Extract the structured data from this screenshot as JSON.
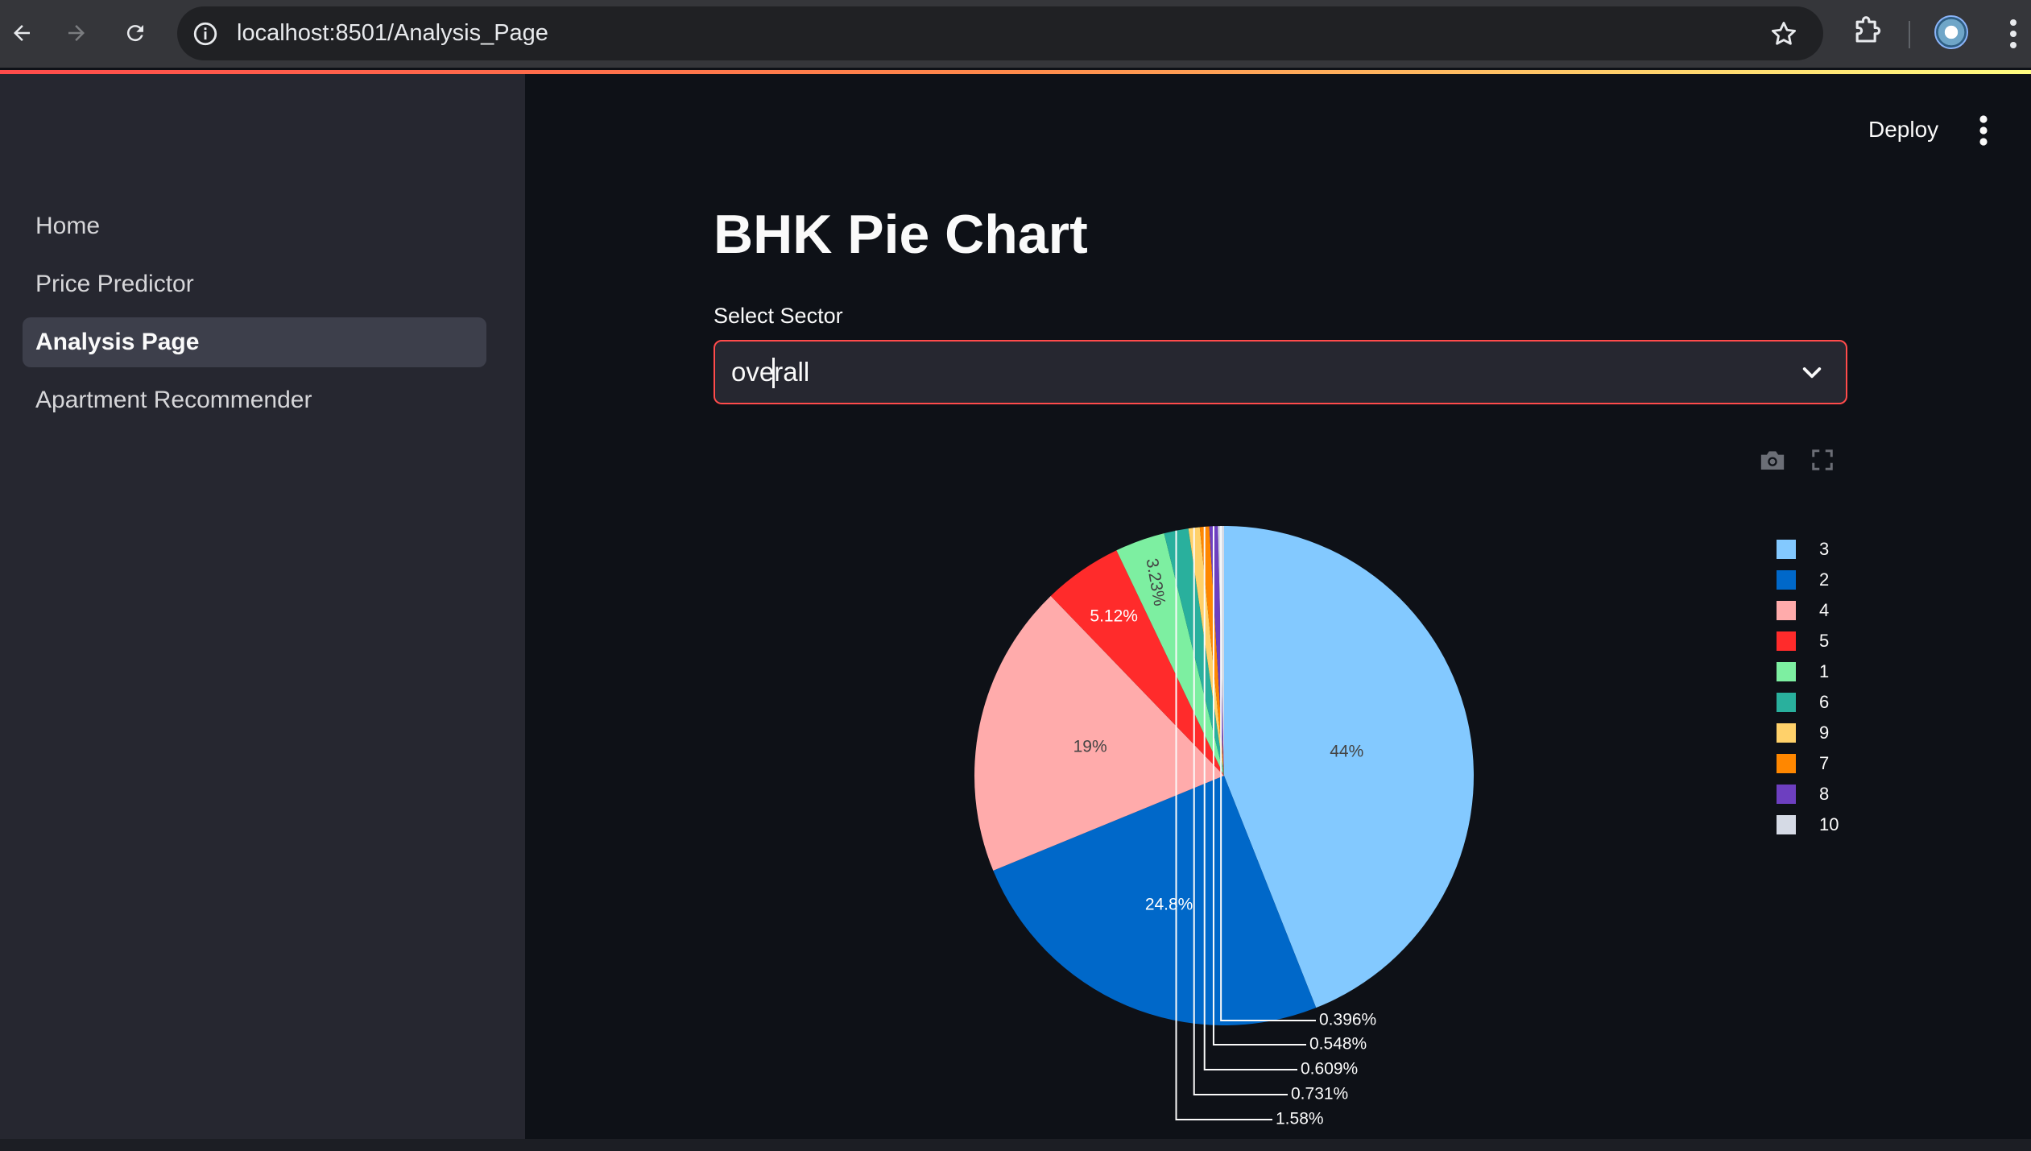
{
  "browser": {
    "url": "localhost:8501/Analysis_Page"
  },
  "sidebar": {
    "items": [
      {
        "label": "Home",
        "active": false
      },
      {
        "label": "Price Predictor",
        "active": false
      },
      {
        "label": "Analysis Page",
        "active": true
      },
      {
        "label": "Apartment Recommender",
        "active": false
      }
    ]
  },
  "header": {
    "deploy_label": "Deploy"
  },
  "main": {
    "title": "BHK Pie Chart",
    "select_label": "Select Sector",
    "select_value": "overall"
  },
  "colors": {
    "accent": "#ff4b4b",
    "background": "#0e1117",
    "sidebar": "#262730"
  },
  "chart_data": {
    "type": "pie",
    "labels": [
      "3",
      "2",
      "4",
      "5",
      "1",
      "6",
      "9",
      "7",
      "8",
      "10"
    ],
    "values": [
      44.0,
      24.8,
      19.0,
      5.12,
      3.23,
      1.58,
      0.731,
      0.609,
      0.548,
      0.396
    ],
    "text_labels": [
      "44%",
      "24.8%",
      "19%",
      "5.12%",
      "3.23%",
      "1.58%",
      "0.731%",
      "0.609%",
      "0.548%",
      "0.396%"
    ],
    "colors": [
      "#83c9ff",
      "#0068c9",
      "#ffabab",
      "#ff2b2b",
      "#7defa1",
      "#29b09d",
      "#ffd16a",
      "#ff8700",
      "#6d3fc0",
      "#d5dae5"
    ],
    "legend_placement": "right",
    "legend_entries": [
      "3",
      "2",
      "4",
      "5",
      "1",
      "6",
      "9",
      "7",
      "8",
      "10"
    ]
  }
}
